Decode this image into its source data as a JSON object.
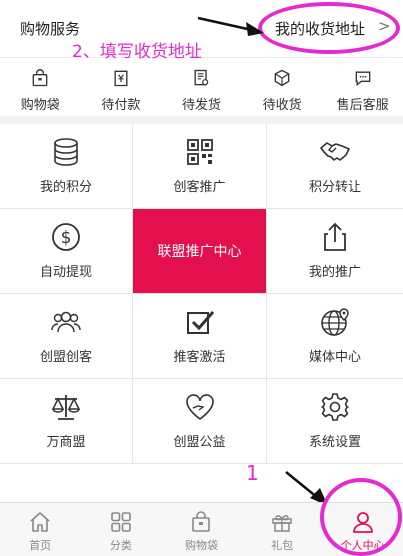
{
  "header": {
    "title": "购物服务",
    "address_link": "我的收货地址",
    "chevron": ">"
  },
  "annotations": {
    "step2": "2、填写收货地址",
    "step1": "1",
    "color": "#e62ad2"
  },
  "orders": [
    {
      "label": "购物袋",
      "icon": "shopping-bag-icon"
    },
    {
      "label": "待付款",
      "icon": "wallet-icon"
    },
    {
      "label": "待发货",
      "icon": "receipt-icon"
    },
    {
      "label": "待收货",
      "icon": "package-icon"
    },
    {
      "label": "售后客服",
      "icon": "chat-icon"
    }
  ],
  "grid": [
    {
      "label": "我的积分",
      "icon": "coins-icon"
    },
    {
      "label": "创客推广",
      "icon": "qr-code-icon"
    },
    {
      "label": "积分转让",
      "icon": "handshake-icon"
    },
    {
      "label": "自动提现",
      "icon": "dollar-icon"
    },
    {
      "label": "联盟推广中心",
      "icon": "",
      "feature": true
    },
    {
      "label": "我的推广",
      "icon": "share-icon"
    },
    {
      "label": "创盟创客",
      "icon": "users-icon"
    },
    {
      "label": "推客激活",
      "icon": "checkbox-icon"
    },
    {
      "label": "媒体中心",
      "icon": "globe-pin-icon"
    },
    {
      "label": "万商盟",
      "icon": "scale-icon"
    },
    {
      "label": "创盟公益",
      "icon": "heart-hand-icon"
    },
    {
      "label": "系统设置",
      "icon": "gear-icon"
    }
  ],
  "tabs": [
    {
      "label": "首页",
      "icon": "home-icon"
    },
    {
      "label": "分类",
      "icon": "grid-icon"
    },
    {
      "label": "购物袋",
      "icon": "shopping-bag-icon"
    },
    {
      "label": "礼包",
      "icon": "gift-icon"
    },
    {
      "label": "个人中心",
      "icon": "user-icon",
      "active": true
    }
  ],
  "colors": {
    "accent": "#e4104e",
    "annotation": "#e62ad2"
  }
}
